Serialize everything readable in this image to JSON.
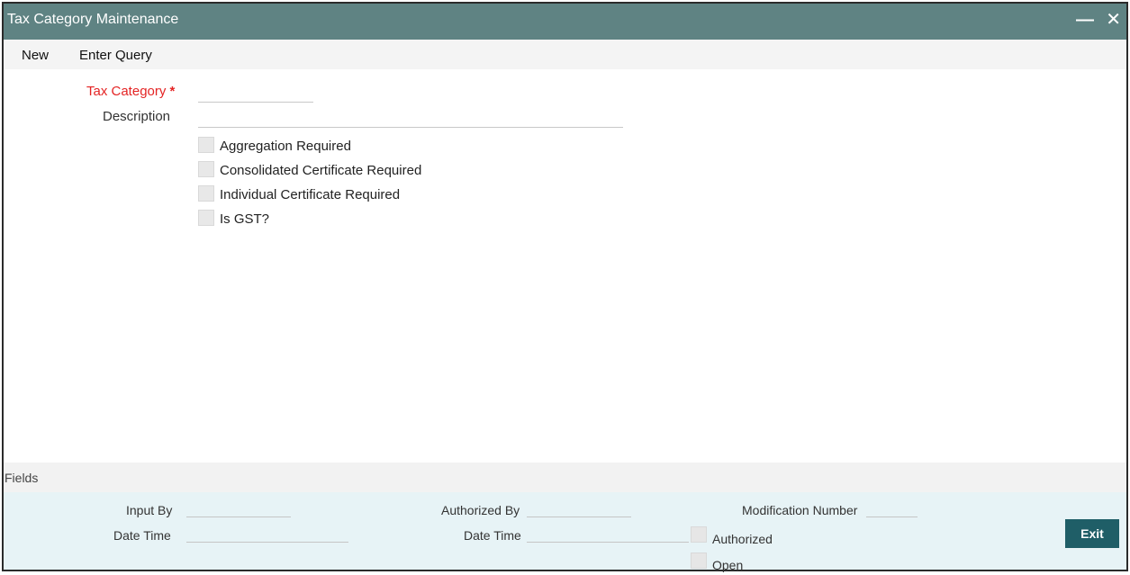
{
  "window": {
    "title": "Tax Category Maintenance"
  },
  "icons": {
    "minimize": "minimize-icon",
    "close": "close-icon"
  },
  "menu": {
    "new_label": "New",
    "enter_query_label": "Enter Query"
  },
  "form": {
    "tax_category_label": "Tax Category",
    "required_marker": "*",
    "tax_category_value": "",
    "description_label": "Description",
    "description_value": "",
    "checkboxes": [
      {
        "label": "Aggregation Required",
        "checked": false
      },
      {
        "label": "Consolidated Certificate Required",
        "checked": false
      },
      {
        "label": "Individual Certificate Required",
        "checked": false
      },
      {
        "label": "Is GST?",
        "checked": false
      }
    ]
  },
  "fields_bar": {
    "label": "Fields"
  },
  "footer": {
    "input_by_label": "Input By",
    "date_time_label": "Date Time",
    "authorized_by_label": "Authorized By",
    "date_time2_label": "Date Time",
    "modification_number_label": "Modification Number",
    "authorized_label": "Authorized",
    "open_label": "Open",
    "exit_label": "Exit"
  },
  "colors": {
    "titlebar": "#5f8383",
    "required": "#e42424",
    "footer_bg": "#e7f3f6",
    "exit_button": "#1f5e67"
  }
}
